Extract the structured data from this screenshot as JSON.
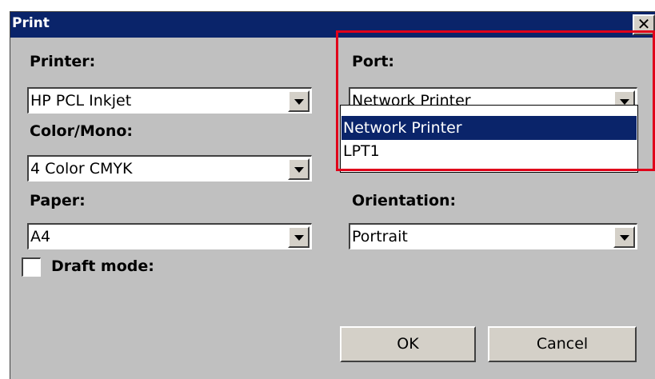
{
  "window": {
    "title": "Print",
    "close_symbol": "✕",
    "close_icon": "close-icon"
  },
  "printer": {
    "label": "Printer:",
    "value": "HP PCL Inkjet"
  },
  "color_mono": {
    "label": "Color/Mono:",
    "value": "4 Color CMYK"
  },
  "paper": {
    "label": "Paper:",
    "value": "A4"
  },
  "port": {
    "label": "Port:",
    "value": "Network Printer",
    "options": [
      "Network Printer",
      "LPT1"
    ],
    "selected_index": 0
  },
  "orientation": {
    "label": "Orientation:",
    "value": "Portrait"
  },
  "draft_mode": {
    "label": "Draft mode:",
    "checked": false
  },
  "buttons": {
    "ok": "OK",
    "cancel": "Cancel"
  },
  "colors": {
    "titlebar": "#0a246a",
    "dialog_bg": "#c0c0c0",
    "selection": "#0a246a",
    "highlight_box": "#e0001a"
  }
}
